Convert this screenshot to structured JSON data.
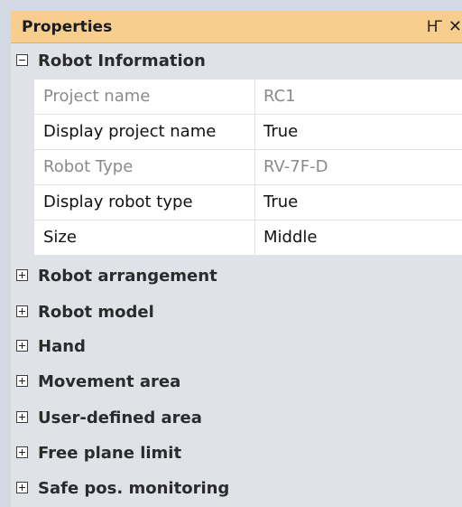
{
  "panel": {
    "title": "Properties",
    "pin_glyph": "ф",
    "close_glyph": "×"
  },
  "categories": [
    {
      "label": "Robot Information",
      "expanded": true,
      "rows": [
        {
          "name": "Project name",
          "value": "RC1",
          "readonly": true
        },
        {
          "name": "Display project name",
          "value": "True",
          "readonly": false
        },
        {
          "name": "Robot Type",
          "value": "RV-7F-D",
          "readonly": true
        },
        {
          "name": "Display robot type",
          "value": "True",
          "readonly": false
        },
        {
          "name": "Size",
          "value": "Middle",
          "readonly": false
        }
      ]
    },
    {
      "label": "Robot arrangement",
      "expanded": false
    },
    {
      "label": "Robot model",
      "expanded": false
    },
    {
      "label": "Hand",
      "expanded": false
    },
    {
      "label": "Movement area",
      "expanded": false
    },
    {
      "label": "User-defined area",
      "expanded": false
    },
    {
      "label": "Free plane limit",
      "expanded": false
    },
    {
      "label": "Safe pos. monitoring",
      "expanded": false
    }
  ],
  "colors": {
    "title_bg": "#f7ce8e",
    "category_bg": "#dfe3e8",
    "row_bg": "#ffffff",
    "readonly_text": "#8a8a8a"
  },
  "icons": {
    "expanded": "collapse-box-minus-icon",
    "collapsed": "expand-box-plus-icon",
    "pin": "pin-icon",
    "close": "close-icon"
  }
}
